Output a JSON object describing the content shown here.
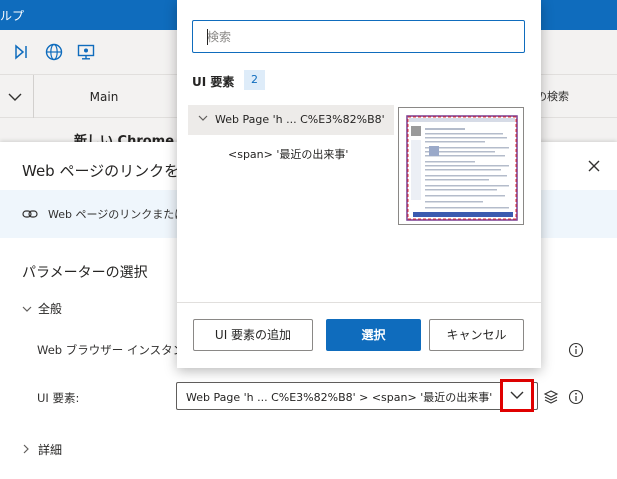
{
  "titlebar": {
    "text": "ルプ"
  },
  "tabs": {
    "main": "Main",
    "variables_search": "変数の検索"
  },
  "canvas": {
    "action_text": "新しい Chrome を"
  },
  "dialog": {
    "title": "Web ページのリンクをクリ",
    "info_text": "Web ページのリンクまたはそ",
    "section_title": "パラメーターの選択",
    "group_general": "全般",
    "label_browser_instance": "Web ブラウザー インスタンス:",
    "label_ui_element": "UI 要素:",
    "ui_element_value": "Web Page 'h ... C%E3%82%B8' > <span> '最近の出来事'",
    "group_advanced": "詳細"
  },
  "picker": {
    "search_placeholder": "検索",
    "ui_elements_label": "UI 要素",
    "count": "2",
    "tree": {
      "parent": "Web Page 'h ... C%E3%82%B8'",
      "child": "<span> '最近の出来事'"
    },
    "buttons": {
      "add": "UI 要素の追加",
      "select": "選択",
      "cancel": "キャンセル"
    }
  },
  "colors": {
    "accent": "#0f6cbd",
    "highlight": "#e00000",
    "info_bg": "#eff6fc"
  }
}
